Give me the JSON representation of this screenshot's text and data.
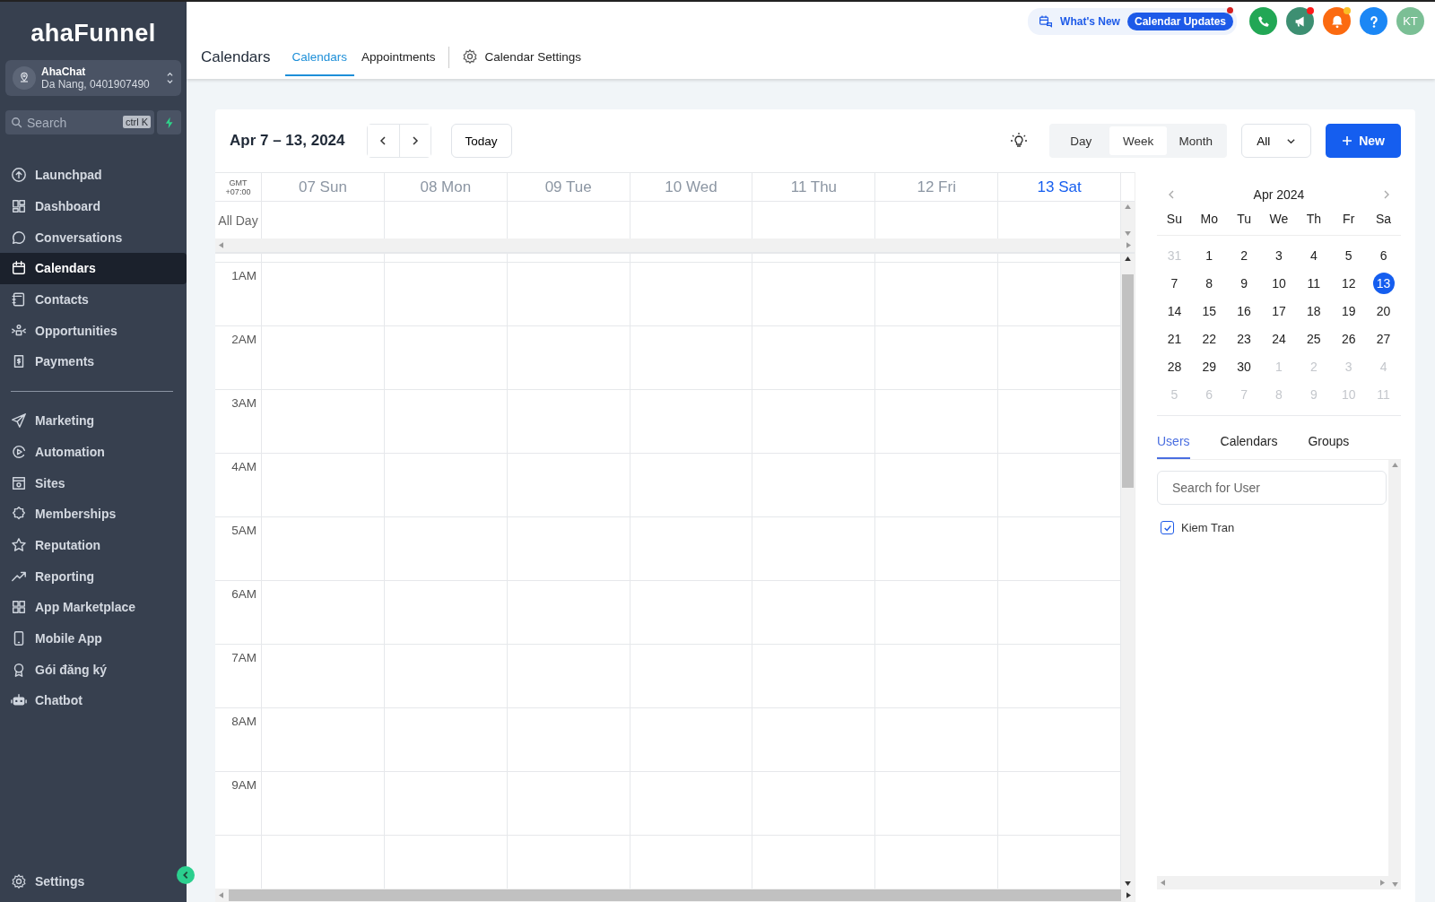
{
  "sidebar": {
    "logo": "ahaFunnel",
    "account": {
      "name": "AhaChat",
      "detail": "Da Nang, 0401907490"
    },
    "search": {
      "placeholder": "Search",
      "shortcut": "ctrl K"
    },
    "groups": [
      [
        {
          "label": "Launchpad",
          "selected": false
        },
        {
          "label": "Dashboard",
          "selected": false
        },
        {
          "label": "Conversations",
          "selected": false
        },
        {
          "label": "Calendars",
          "selected": true
        },
        {
          "label": "Contacts",
          "selected": false
        },
        {
          "label": "Opportunities",
          "selected": false
        },
        {
          "label": "Payments",
          "selected": false
        }
      ],
      [
        {
          "label": "Marketing",
          "selected": false
        },
        {
          "label": "Automation",
          "selected": false
        },
        {
          "label": "Sites",
          "selected": false
        },
        {
          "label": "Memberships",
          "selected": false
        },
        {
          "label": "Reputation",
          "selected": false
        },
        {
          "label": "Reporting",
          "selected": false
        },
        {
          "label": "App Marketplace",
          "selected": false
        },
        {
          "label": "Mobile App",
          "selected": false
        },
        {
          "label": "Gói đăng ký",
          "selected": false
        },
        {
          "label": "Chatbot",
          "selected": false
        }
      ]
    ],
    "settings": "Settings"
  },
  "header": {
    "whats_new": "What's New",
    "updates_badge": "Calendar Updates",
    "updates_dot": true,
    "icon_buttons": [
      {
        "kind": "phone",
        "color": "#22a755"
      },
      {
        "kind": "megaphone",
        "color": "#3d8f72",
        "dot": {
          "color": "#ff1a1a"
        }
      },
      {
        "kind": "bell",
        "color": "#fb6a10",
        "dot": {
          "color": "#fbbf24"
        }
      },
      {
        "kind": "help",
        "color": "#1b87f5"
      }
    ],
    "avatar": {
      "initials": "KT",
      "color": "#7bbf95"
    },
    "title": "Calendars",
    "tabs": [
      {
        "label": "Calendars",
        "selected": true
      },
      {
        "label": "Appointments",
        "selected": false
      }
    ],
    "settings_tab": "Calendar Settings"
  },
  "toolbar": {
    "range": "Apr 7 – 13, 2024",
    "today": "Today",
    "views": [
      {
        "label": "Day",
        "selected": false
      },
      {
        "label": "Week",
        "selected": true
      },
      {
        "label": "Month",
        "selected": false
      }
    ],
    "filter": "All",
    "new_button": "New"
  },
  "week": {
    "timezone": {
      "label": "GMT",
      "offset": "+07:00"
    },
    "all_day": "All Day",
    "days": [
      {
        "label": "07 Sun",
        "selected": false
      },
      {
        "label": "08 Mon",
        "selected": false
      },
      {
        "label": "09 Tue",
        "selected": false
      },
      {
        "label": "10 Wed",
        "selected": false
      },
      {
        "label": "11 Thu",
        "selected": false
      },
      {
        "label": "12 Fri",
        "selected": false
      },
      {
        "label": "13 Sat",
        "selected": true
      }
    ],
    "hours": [
      "1AM",
      "2AM",
      "3AM",
      "4AM",
      "5AM",
      "6AM",
      "7AM",
      "8AM",
      "9AM"
    ]
  },
  "mini_calendar": {
    "month": "Apr 2024",
    "weekdays": [
      "Su",
      "Mo",
      "Tu",
      "We",
      "Th",
      "Fr",
      "Sa"
    ],
    "weeks": [
      [
        {
          "day": "31",
          "muted": true,
          "selected": false
        },
        {
          "day": "1",
          "muted": false,
          "selected": false
        },
        {
          "day": "2",
          "muted": false,
          "selected": false
        },
        {
          "day": "3",
          "muted": false,
          "selected": false
        },
        {
          "day": "4",
          "muted": false,
          "selected": false
        },
        {
          "day": "5",
          "muted": false,
          "selected": false
        },
        {
          "day": "6",
          "muted": false,
          "selected": false
        }
      ],
      [
        {
          "day": "7",
          "muted": false,
          "selected": false
        },
        {
          "day": "8",
          "muted": false,
          "selected": false
        },
        {
          "day": "9",
          "muted": false,
          "selected": false
        },
        {
          "day": "10",
          "muted": false,
          "selected": false
        },
        {
          "day": "11",
          "muted": false,
          "selected": false
        },
        {
          "day": "12",
          "muted": false,
          "selected": false
        },
        {
          "day": "13",
          "muted": false,
          "selected": true
        }
      ],
      [
        {
          "day": "14",
          "muted": false,
          "selected": false
        },
        {
          "day": "15",
          "muted": false,
          "selected": false
        },
        {
          "day": "16",
          "muted": false,
          "selected": false
        },
        {
          "day": "17",
          "muted": false,
          "selected": false
        },
        {
          "day": "18",
          "muted": false,
          "selected": false
        },
        {
          "day": "19",
          "muted": false,
          "selected": false
        },
        {
          "day": "20",
          "muted": false,
          "selected": false
        }
      ],
      [
        {
          "day": "21",
          "muted": false,
          "selected": false
        },
        {
          "day": "22",
          "muted": false,
          "selected": false
        },
        {
          "day": "23",
          "muted": false,
          "selected": false
        },
        {
          "day": "24",
          "muted": false,
          "selected": false
        },
        {
          "day": "25",
          "muted": false,
          "selected": false
        },
        {
          "day": "26",
          "muted": false,
          "selected": false
        },
        {
          "day": "27",
          "muted": false,
          "selected": false
        }
      ],
      [
        {
          "day": "28",
          "muted": false,
          "selected": false
        },
        {
          "day": "29",
          "muted": false,
          "selected": false
        },
        {
          "day": "30",
          "muted": false,
          "selected": false
        },
        {
          "day": "1",
          "muted": true,
          "selected": false
        },
        {
          "day": "2",
          "muted": true,
          "selected": false
        },
        {
          "day": "3",
          "muted": true,
          "selected": false
        },
        {
          "day": "4",
          "muted": true,
          "selected": false
        }
      ],
      [
        {
          "day": "5",
          "muted": true,
          "selected": false
        },
        {
          "day": "6",
          "muted": true,
          "selected": false
        },
        {
          "day": "7",
          "muted": true,
          "selected": false
        },
        {
          "day": "8",
          "muted": true,
          "selected": false
        },
        {
          "day": "9",
          "muted": true,
          "selected": false
        },
        {
          "day": "10",
          "muted": true,
          "selected": false
        },
        {
          "day": "11",
          "muted": true,
          "selected": false
        }
      ]
    ]
  },
  "filter_panel": {
    "tabs": [
      {
        "label": "Users",
        "selected": true
      },
      {
        "label": "Calendars",
        "selected": false
      },
      {
        "label": "Groups",
        "selected": false
      }
    ],
    "search": {
      "placeholder": "Search for User"
    },
    "users": [
      {
        "name": "Kiem Tran",
        "checked": true
      }
    ]
  }
}
